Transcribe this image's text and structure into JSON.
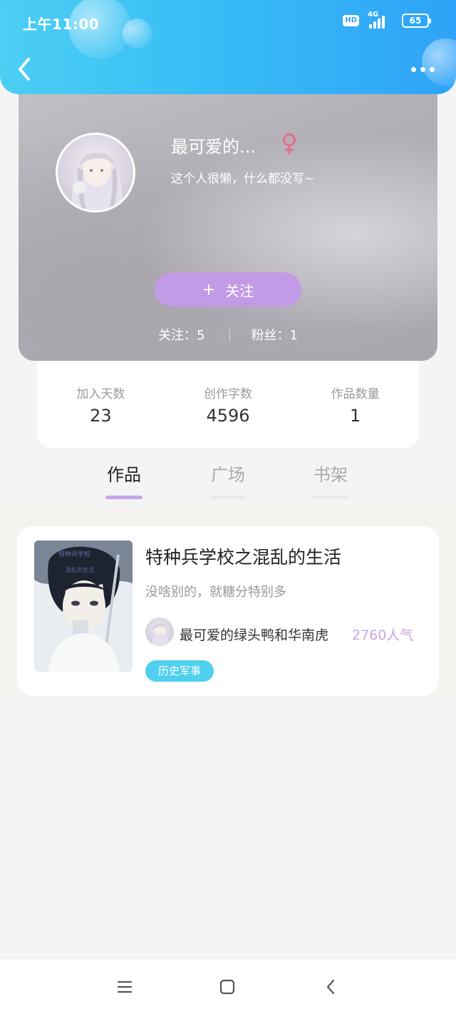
{
  "status_bar": {
    "time": "上午11:00",
    "hd_badge": "HD",
    "network": "4G",
    "battery": "65"
  },
  "header": {
    "back_icon": "chevron-left-icon",
    "more_icon": "more-dots-icon"
  },
  "profile": {
    "nickname": "最可爱的...",
    "gender_symbol": "♀",
    "gender_color": "#e3708b",
    "signature": "这个人很懒，什么都没写~",
    "follow_plus": "+",
    "follow_label": "关注",
    "following": "关注：5",
    "fans": "粉丝：1"
  },
  "stats": [
    {
      "label": "加入天数",
      "value": "23"
    },
    {
      "label": "创作字数",
      "value": "4596"
    },
    {
      "label": "作品数量",
      "value": "1"
    }
  ],
  "tabs": [
    {
      "label": "作品",
      "active": true
    },
    {
      "label": "广场",
      "active": false
    },
    {
      "label": "书架",
      "active": false
    }
  ],
  "works": [
    {
      "title": "特种兵学校之混乱的生活",
      "description": "没啥别的，就糖分特别多",
      "author": "最可爱的绿头鸭和华南虎",
      "popularity": "2760人气",
      "tag": "历史军事"
    }
  ],
  "nav": {
    "menu_icon": "menu-icon",
    "home_icon": "home-square-icon",
    "back_icon": "back-triangle-icon"
  },
  "colors": {
    "header_gradient_start": "#4ccff3",
    "header_gradient_end": "#2fa3f7",
    "follow_button": "#c39ae6",
    "active_tab_underline": "#c6a4ea",
    "popularity": "#c9a3ea",
    "tag_background": "#4fd0ee"
  }
}
